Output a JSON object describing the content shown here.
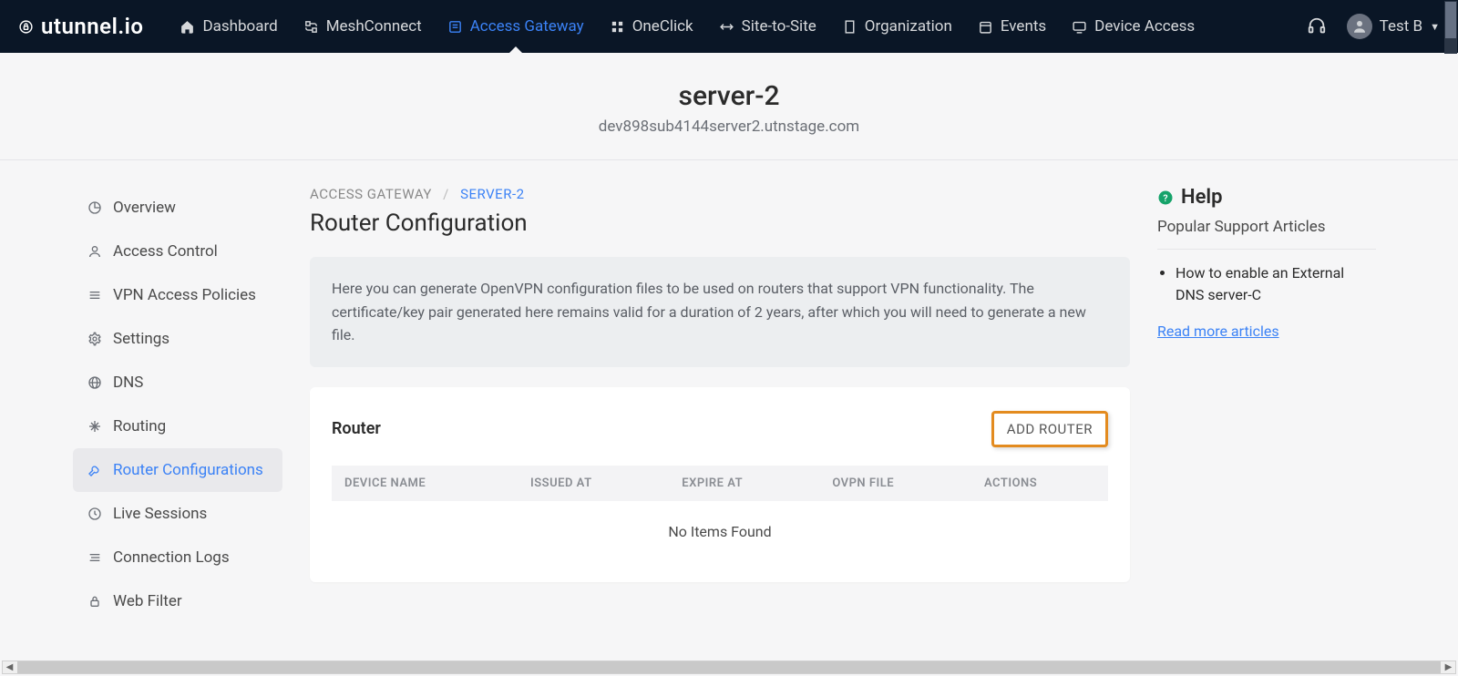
{
  "brand": "utunnel.io",
  "nav": {
    "items": [
      {
        "label": "Dashboard",
        "active": false
      },
      {
        "label": "MeshConnect",
        "active": false
      },
      {
        "label": "Access Gateway",
        "active": true
      },
      {
        "label": "OneClick",
        "active": false
      },
      {
        "label": "Site-to-Site",
        "active": false
      },
      {
        "label": "Organization",
        "active": false
      },
      {
        "label": "Events",
        "active": false
      },
      {
        "label": "Device Access",
        "active": false
      }
    ],
    "user": "Test B"
  },
  "server": {
    "title": "server-2",
    "subtitle": "dev898sub4144server2.utnstage.com"
  },
  "sidebar": {
    "items": [
      {
        "label": "Overview"
      },
      {
        "label": "Access Control"
      },
      {
        "label": "VPN Access Policies"
      },
      {
        "label": "Settings"
      },
      {
        "label": "DNS"
      },
      {
        "label": "Routing"
      },
      {
        "label": "Router Configurations"
      },
      {
        "label": "Live Sessions"
      },
      {
        "label": "Connection Logs"
      },
      {
        "label": "Web Filter"
      }
    ],
    "active_index": 6
  },
  "breadcrumb": {
    "root": "ACCESS GATEWAY",
    "current": "SERVER-2"
  },
  "page": {
    "title": "Router Configuration"
  },
  "info": "Here you can generate OpenVPN configuration files to be used on routers that support VPN functionality. The certificate/key pair generated here remains valid for a duration of 2 years, after which you will need to generate a new file.",
  "card": {
    "title": "Router",
    "add_label": "ADD ROUTER",
    "columns": [
      "DEVICE NAME",
      "ISSUED AT",
      "EXPIRE AT",
      "OVPN FILE",
      "ACTIONS"
    ],
    "empty": "No Items Found"
  },
  "help": {
    "title": "Help",
    "subtitle": "Popular Support Articles",
    "articles": [
      "How to enable an External DNS server-C"
    ],
    "read_more": "Read more articles"
  }
}
